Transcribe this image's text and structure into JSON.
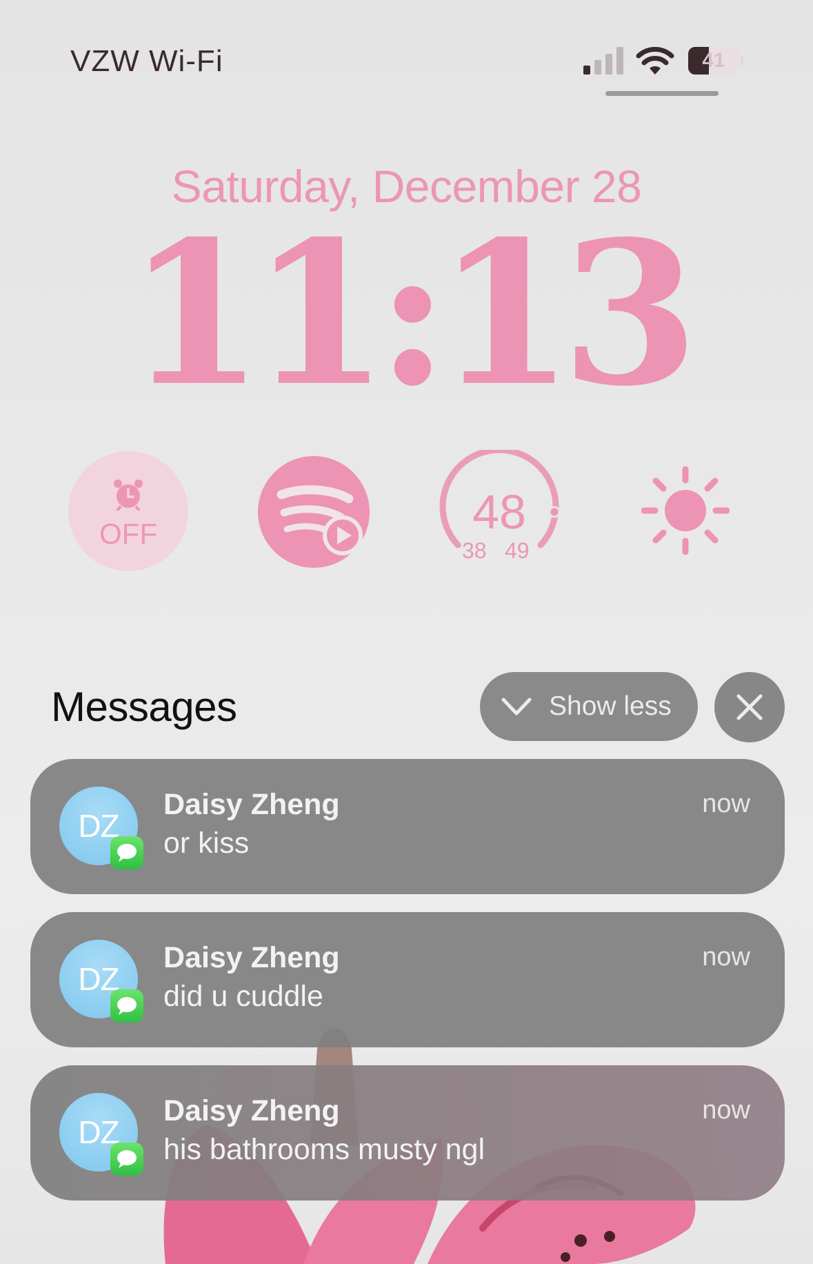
{
  "status_bar": {
    "carrier": "VZW Wi-Fi",
    "battery_level": "41",
    "battery_percent": 41,
    "signal_bars_active": 1,
    "signal_bars_total": 4
  },
  "lock_screen": {
    "date": "Saturday, December 28",
    "time": "11:13"
  },
  "widgets": {
    "alarm": {
      "icon": "alarm-clock-icon",
      "label": "OFF"
    },
    "spotify": {
      "icon": "spotify-icon"
    },
    "weather": {
      "temp": "48",
      "low": "38",
      "high": "49"
    },
    "brightness": {
      "icon": "sun-icon"
    }
  },
  "notification_group": {
    "app_title": "Messages",
    "show_less_label": "Show less",
    "notifications": [
      {
        "initials": "DZ",
        "sender": "Daisy Zheng",
        "message": "or kiss",
        "time": "now"
      },
      {
        "initials": "DZ",
        "sender": "Daisy Zheng",
        "message": "did u cuddle",
        "time": "now"
      },
      {
        "initials": "DZ",
        "sender": "Daisy Zheng",
        "message": "his bathrooms musty ngl",
        "time": "now"
      }
    ]
  },
  "colors": {
    "accent_pink": "#ed93b3",
    "card_gray": "#808080",
    "avatar_blue": "#8acdf0",
    "messages_green": "#34c759"
  }
}
